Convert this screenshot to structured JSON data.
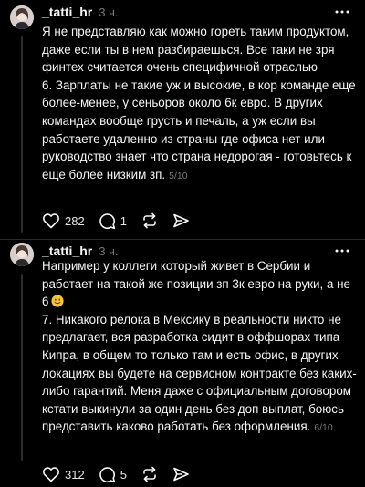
{
  "posts": [
    {
      "username": "_tatti_hr",
      "timestamp": "3 ч.",
      "paragraphs": [
        "Я не представляю как можно гореть таким продуктом, даже если ты в нем разбираешься. Все таки не зря финтех считается очень специфичной отраслью",
        "6. Зарплаты не такие уж и высокие, в кор команде еще более-менее, у сеньоров около 6к евро. В других командах вообще грусть и печаль, а уж если вы работаете удаленно из страны где офиса нет или руководство знает что страна недорогая - готовьтесь к еще более низким зп."
      ],
      "page_counter": "5/10",
      "likes": "282",
      "comments": "1",
      "has_emoji": false
    },
    {
      "username": "_tatti_hr",
      "timestamp": "3 ч.",
      "paragraphs": [
        "Например у коллеги который живет в Сербии и работает на такой же позиции зп 3к евро на руки, а не 6",
        "7. Никакого релока в Мексику в реальности никто не предлагает, вся разработка сидит в оффшорах типа Кипра, в общем то только там и есть офис, в других локациях вы будете на сервисном контракте без каких-либо гарантий. Меня даже с официальным договором кстати выкинули за один день без доп выплат, боюсь представить каково работать без оформления."
      ],
      "page_counter": "6/10",
      "likes": "312",
      "comments": "5",
      "has_emoji": true
    }
  ],
  "icons": {
    "more": "more-icon",
    "like": "heart-icon",
    "comment": "comment-icon",
    "repost": "repost-icon",
    "share": "share-icon",
    "emoji": "slightly-smiling-face-emoji"
  },
  "colors": {
    "background": "#000000",
    "text": "#f3f5f7",
    "secondary": "#777777",
    "thread_line": "#2d2d2d"
  }
}
